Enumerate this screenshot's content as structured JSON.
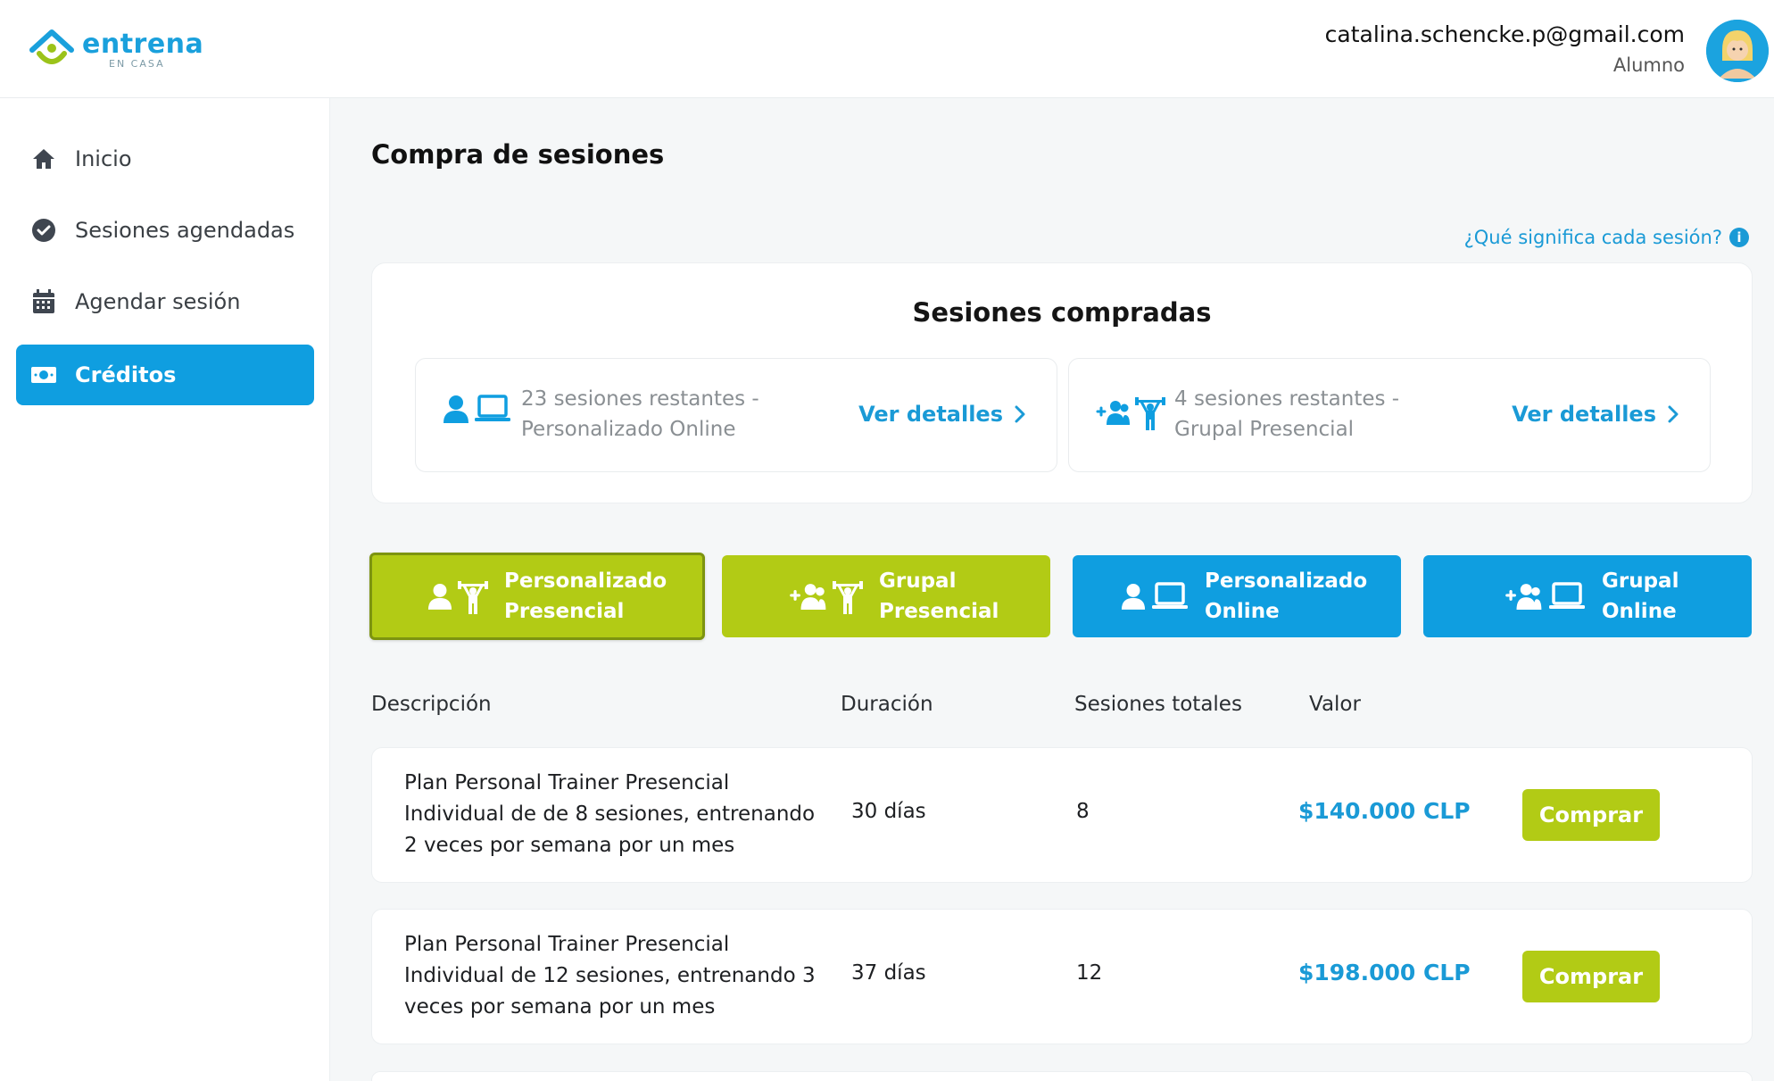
{
  "brand": {
    "name": "entrena",
    "sub": "EN CASA"
  },
  "user": {
    "email": "catalina.schencke.p@gmail.com",
    "role": "Alumno"
  },
  "sidebar": {
    "items": [
      {
        "label": "Inicio",
        "icon": "home-icon",
        "active": false
      },
      {
        "label": "Sesiones agendadas",
        "icon": "check-circle-icon",
        "active": false
      },
      {
        "label": "Agendar sesión",
        "icon": "calendar-icon",
        "active": false
      },
      {
        "label": "Créditos",
        "icon": "money-icon",
        "active": true
      }
    ]
  },
  "main": {
    "title": "Compra de sesiones",
    "help_link": "¿Qué significa cada sesión?",
    "purchased": {
      "title": "Sesiones compradas",
      "items": [
        {
          "text": "23 sesiones restantes - Personalizado Online",
          "link": "Ver detalles"
        },
        {
          "text": "4 sesiones restantes - Grupal Presencial",
          "link": "Ver detalles"
        }
      ]
    },
    "types": [
      {
        "label_1": "Personalizado",
        "label_2": "Presencial",
        "color": "#b2cb15",
        "selected": true
      },
      {
        "label_1": "Grupal",
        "label_2": "Presencial",
        "color": "#b2cb15",
        "selected": false
      },
      {
        "label_1": "Personalizado",
        "label_2": "Online",
        "color": "#0f9ee0",
        "selected": false
      },
      {
        "label_1": "Grupal",
        "label_2": "Online",
        "color": "#0f9ee0",
        "selected": false
      }
    ],
    "table": {
      "headers": [
        "Descripción",
        "Duración",
        "Sesiones totales",
        "Valor"
      ],
      "rows": [
        {
          "description": "Plan Personal Trainer Presencial Individual de de 8 sesiones, entrenando 2 veces por semana por un mes",
          "duration": "30 días",
          "sessions": "8",
          "price": "$140.000 CLP",
          "button": "Comprar"
        },
        {
          "description": "Plan Personal Trainer Presencial Individual de 12 sesiones, entrenando 3 veces por semana por un mes",
          "duration": "37 días",
          "sessions": "12",
          "price": "$198.000 CLP",
          "button": "Comprar"
        }
      ]
    }
  },
  "colors": {
    "accent_blue": "#0f9ee0",
    "accent_green": "#b2cb15",
    "link_blue": "#1a9ad6"
  }
}
